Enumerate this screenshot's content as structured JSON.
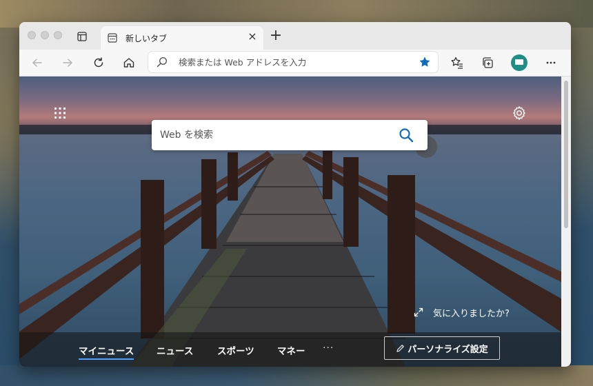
{
  "tab": {
    "title": "新しいタブ"
  },
  "toolbar": {
    "address_placeholder": "検索または Web アドレスを入力"
  },
  "page": {
    "search_placeholder": "Web を検索",
    "feedback_text": "気に入りましたか?",
    "news_tabs": [
      {
        "label": "マイニュース"
      },
      {
        "label": "ニュース"
      },
      {
        "label": "スポーツ"
      },
      {
        "label": "マネー"
      }
    ],
    "more_label": "···",
    "personalize_label": "パーソナライズ設定"
  },
  "colors": {
    "accent": "#0078d4",
    "profile": "#1f8f86",
    "news_active_underline": "#4ea1ff"
  },
  "icons": [
    "tab-actions-icon",
    "new-tab-icon",
    "back-icon",
    "forward-icon",
    "refresh-icon",
    "home-icon",
    "search-icon",
    "favorite-star-icon",
    "favorites-icon",
    "collections-icon",
    "profile-icon",
    "more-icon",
    "apps-grid-icon",
    "settings-gear-icon",
    "expand-icon",
    "pencil-icon"
  ]
}
